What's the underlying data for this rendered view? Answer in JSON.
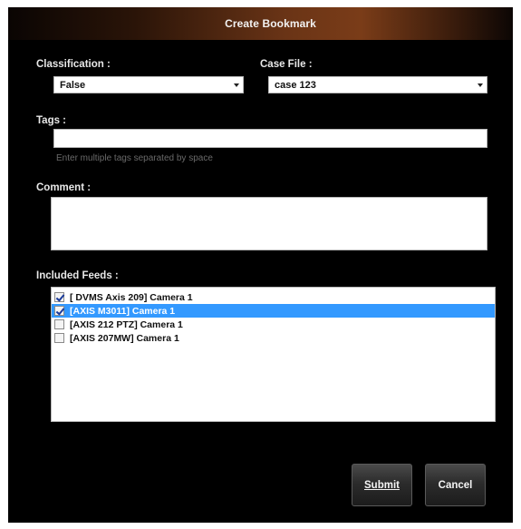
{
  "dialog": {
    "title": "Create Bookmark"
  },
  "classification": {
    "label": "Classification :",
    "value": "False"
  },
  "case_file": {
    "label": "Case File :",
    "value": "case 123"
  },
  "tags": {
    "label": "Tags :",
    "value": "",
    "hint": "Enter multiple tags separated by space"
  },
  "comment": {
    "label": "Comment :",
    "value": ""
  },
  "feeds": {
    "label": "Included Feeds :",
    "items": [
      {
        "label": "[ DVMS Axis 209] Camera 1",
        "checked": true,
        "selected": false
      },
      {
        "label": "[AXIS M3011] Camera 1",
        "checked": true,
        "selected": true
      },
      {
        "label": "[AXIS 212 PTZ] Camera 1",
        "checked": false,
        "selected": false
      },
      {
        "label": "[AXIS 207MW] Camera 1",
        "checked": false,
        "selected": false
      }
    ]
  },
  "buttons": {
    "submit": "Submit",
    "cancel": "Cancel"
  }
}
